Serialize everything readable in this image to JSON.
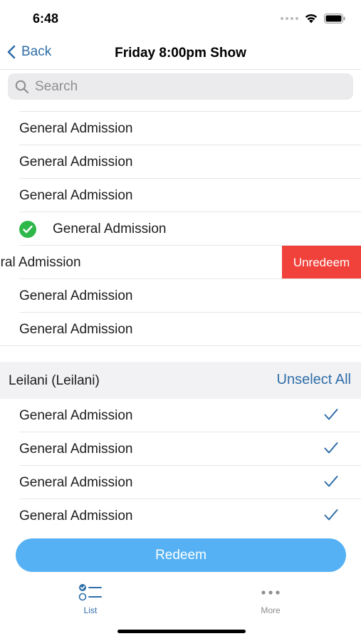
{
  "status_bar": {
    "time": "6:48"
  },
  "nav": {
    "back_label": "Back",
    "title": "Friday 8:00pm Show"
  },
  "search": {
    "placeholder": "Search"
  },
  "tickets": [
    {
      "label": "General Admission"
    },
    {
      "label": "General Admission"
    },
    {
      "label": "General Admission"
    },
    {
      "label": "General Admission",
      "state": "redeemed"
    },
    {
      "label": "eral Admission",
      "state": "swiped",
      "action": "Unredeem"
    },
    {
      "label": "General Admission"
    },
    {
      "label": "General Admission"
    }
  ],
  "group": {
    "title": "Leilani (Leilani)",
    "unselect_all_label": "Unselect All",
    "items": [
      {
        "label": "General Admission",
        "selected": true
      },
      {
        "label": "General Admission",
        "selected": true
      },
      {
        "label": "General Admission",
        "selected": true
      },
      {
        "label": "General Admission",
        "selected": true
      }
    ]
  },
  "redeem_button": {
    "label": "Redeem"
  },
  "tab_bar": {
    "tabs": [
      {
        "label": "List",
        "icon": "list-icon",
        "active": true
      },
      {
        "label": "More",
        "icon": "more-icon",
        "active": false
      }
    ]
  },
  "colors": {
    "accent": "#2f6ea8",
    "redeem_button": "#55b1f3",
    "unredeem_action": "#f0413b",
    "redeemed_check": "#2fb84a"
  }
}
